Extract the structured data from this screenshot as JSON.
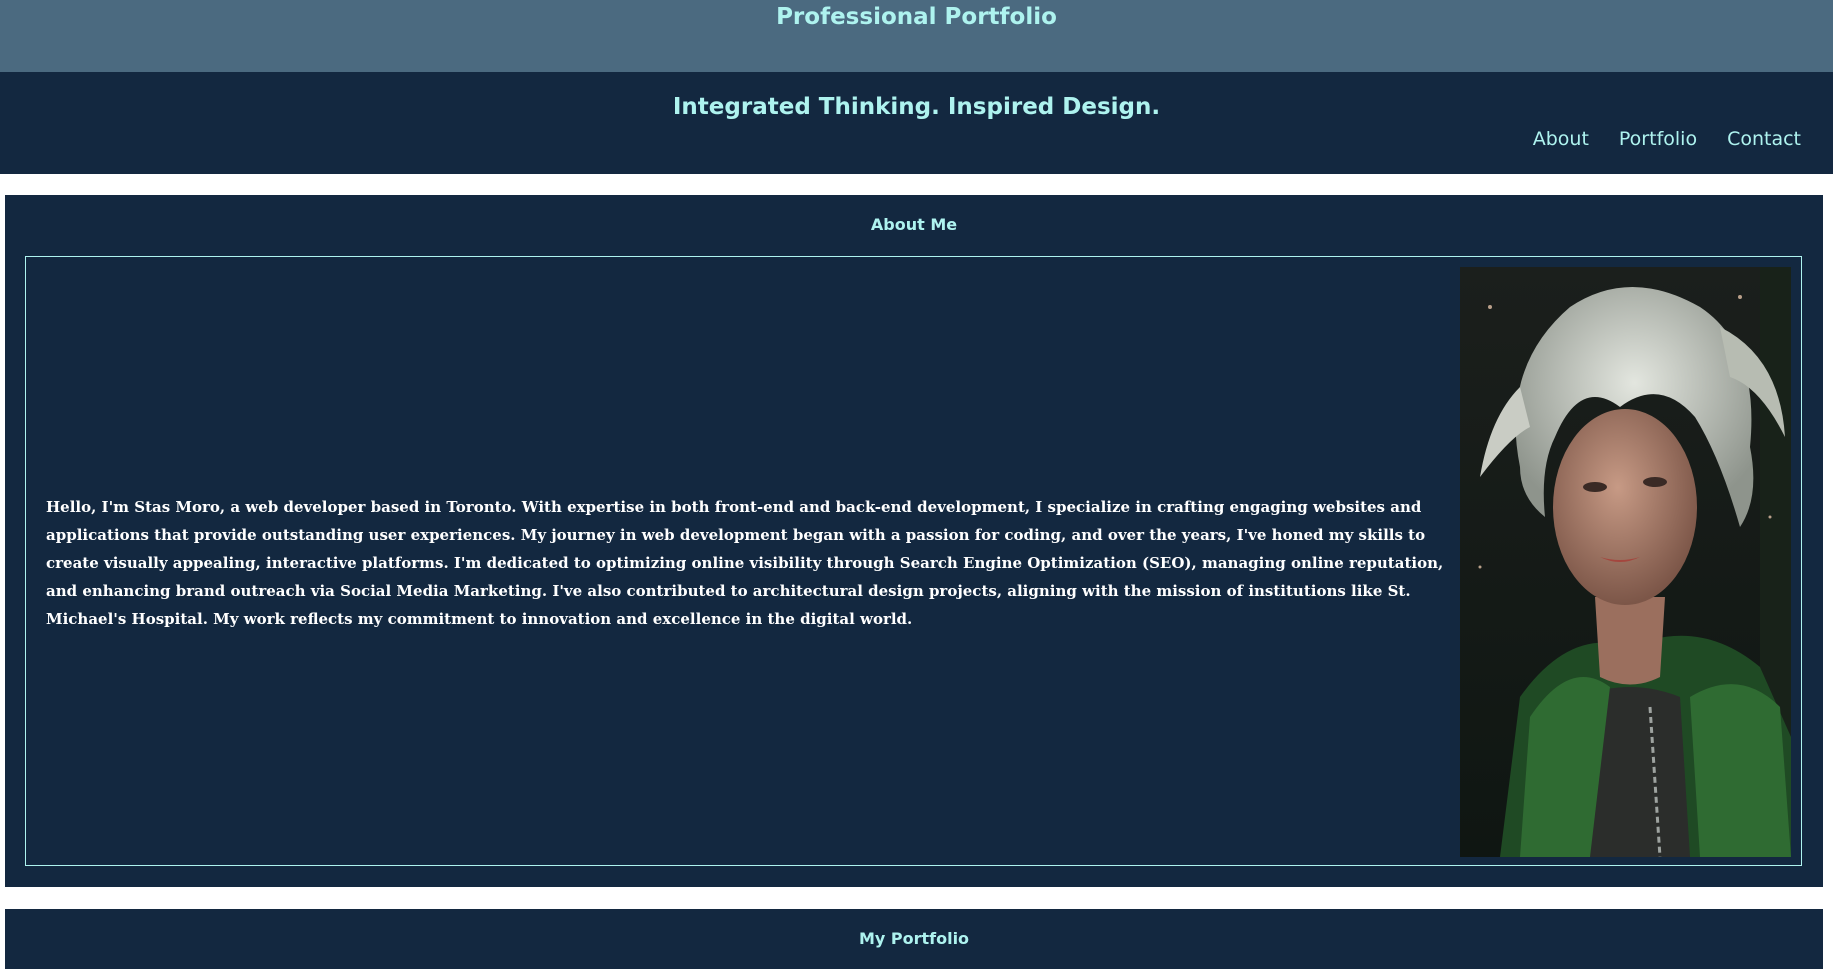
{
  "site": {
    "title": "Professional Portfolio",
    "tagline": "Integrated Thinking. Inspired Design."
  },
  "nav": {
    "items": [
      {
        "label": "About"
      },
      {
        "label": "Portfolio"
      },
      {
        "label": "Contact"
      }
    ]
  },
  "about": {
    "title": "About Me",
    "text": "Hello, I'm Stas Moro, a web developer based in Toronto. With expertise in both front-end and back-end development, I specialize in crafting engaging websites and applications that provide outstanding user experiences. My journey in web development began with a passion for coding, and over the years, I've honed my skills to create visually appealing, interactive platforms. I'm dedicated to optimizing online visibility through Search Engine Optimization (SEO), managing online reputation, and enhancing brand outreach via Social Media Marketing. I've also contributed to architectural design projects, aligning with the mission of institutions like St. Michael's Hospital. My work reflects my commitment to innovation and excellence in the digital world."
  },
  "portfolio": {
    "title": "My Portfolio"
  },
  "colors": {
    "banner": "#4b6a80",
    "navy": "#132840",
    "accent": "#aef3ef"
  }
}
